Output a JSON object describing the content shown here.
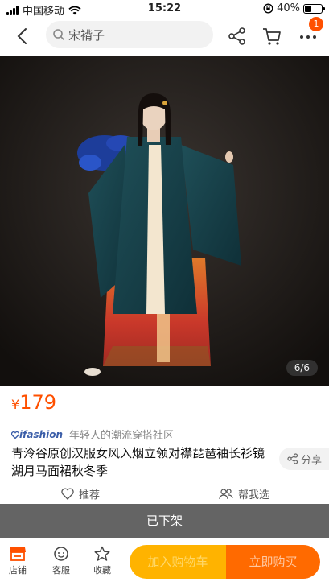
{
  "status_bar": {
    "carrier": "中国移动",
    "time": "15:22",
    "battery": "40%",
    "battery_level": 0.4
  },
  "nav": {
    "search_placeholder": "宋褙子",
    "cart_badge": "1"
  },
  "gallery": {
    "counter": "6/6"
  },
  "product": {
    "currency": "¥",
    "price": "179",
    "community_brand": "ifashion",
    "community_text": "年轻人的潮流穿搭社区",
    "title": "青泠谷原创汉服女风入烟立领对襟琵琶袖长衫镜湖月马面裙秋冬季",
    "share_label": "分享"
  },
  "recommendations": {
    "recommend_label": "推荐",
    "help_choose_label": "帮我选"
  },
  "status_banner": "已下架",
  "bottom_bar": {
    "store_label": "店铺",
    "service_label": "客服",
    "favorite_label": "收藏",
    "add_to_cart_label": "加入购物车",
    "buy_now_label": "立即购买"
  },
  "colors": {
    "accent": "#ff5000",
    "cart_button": "#ffb300",
    "buy_button": "#ff6a00",
    "banner": "#646464"
  }
}
